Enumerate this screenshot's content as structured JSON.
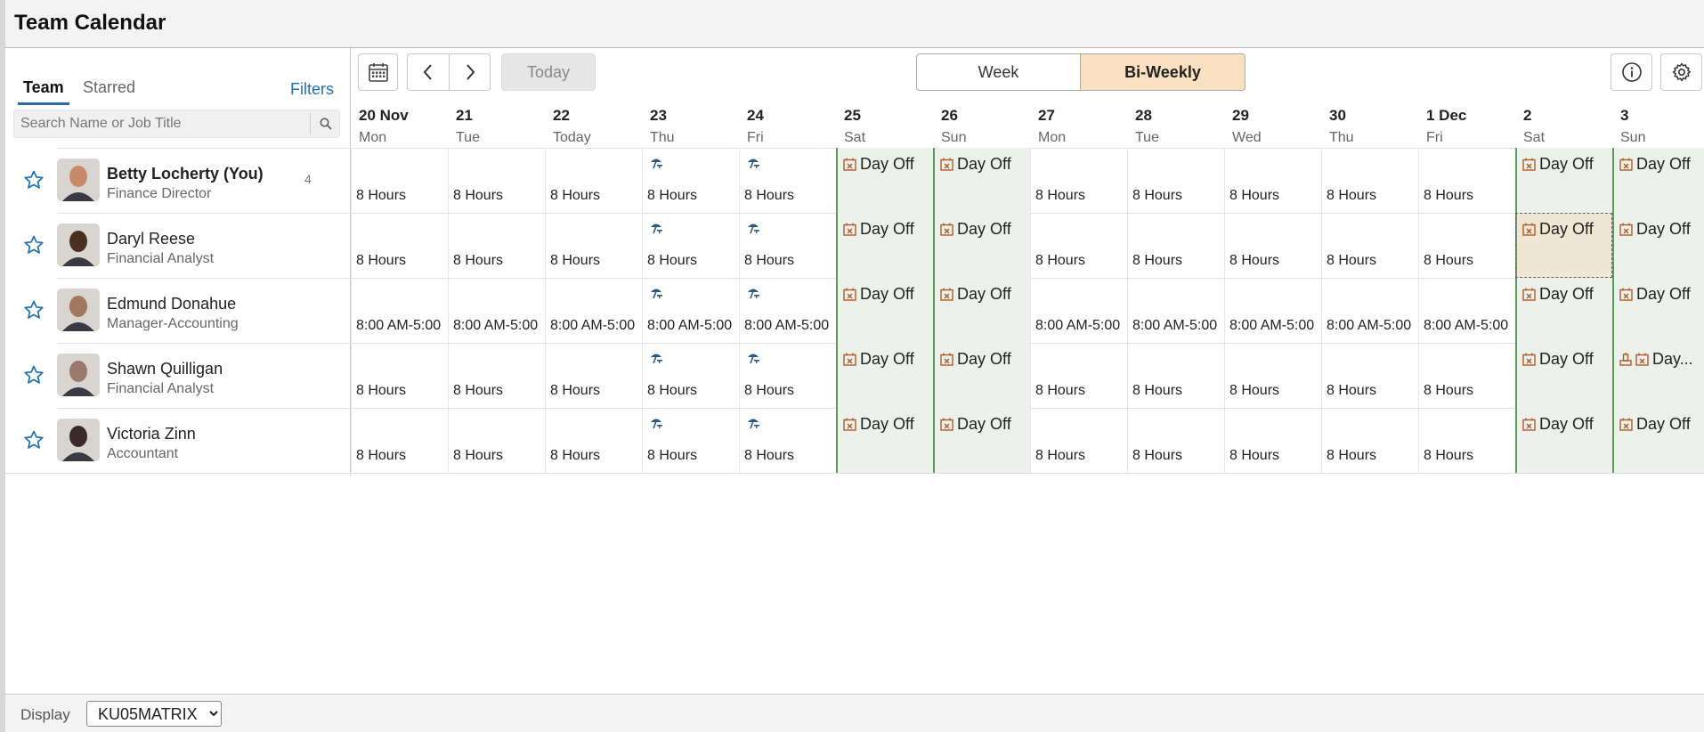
{
  "app": {
    "title": "Team Calendar"
  },
  "tabs": {
    "team": "Team",
    "starred": "Starred"
  },
  "filters_label": "Filters",
  "search": {
    "placeholder": "Search Name or Job Title"
  },
  "toolbar": {
    "today": "Today",
    "week": "Week",
    "biweekly": "Bi-Weekly"
  },
  "colors": {
    "accent": "#1f6fb0",
    "selected_view": "#f8e0c0",
    "weekend": "#ecf2eb",
    "weekend_border": "#5c9a5c",
    "day_off_icon": "#b05a2a",
    "holiday_icon": "#2a5a80"
  },
  "days": [
    {
      "date": "20 Nov",
      "wd": "Mon",
      "weekend": false
    },
    {
      "date": "21",
      "wd": "Tue",
      "weekend": false
    },
    {
      "date": "22",
      "wd": "Today",
      "weekend": false
    },
    {
      "date": "23",
      "wd": "Thu",
      "weekend": false
    },
    {
      "date": "24",
      "wd": "Fri",
      "weekend": false
    },
    {
      "date": "25",
      "wd": "Sat",
      "weekend": true
    },
    {
      "date": "26",
      "wd": "Sun",
      "weekend": true
    },
    {
      "date": "27",
      "wd": "Mon",
      "weekend": false
    },
    {
      "date": "28",
      "wd": "Tue",
      "weekend": false
    },
    {
      "date": "29",
      "wd": "Wed",
      "weekend": false
    },
    {
      "date": "30",
      "wd": "Thu",
      "weekend": false
    },
    {
      "date": "1 Dec",
      "wd": "Fri",
      "weekend": false
    },
    {
      "date": "2",
      "wd": "Sat",
      "weekend": true
    },
    {
      "date": "3",
      "wd": "Sun",
      "weekend": true
    }
  ],
  "day_off_label": "Day Off",
  "employees": [
    {
      "name": "Betty Locherty (You)",
      "job": "Finance Director",
      "count": "4",
      "bold": true,
      "hue": "#c98a6a",
      "cells": [
        "8 Hours",
        "8 Hours",
        "8 Hours",
        "H:8 Hours",
        "H:8 Hours",
        "OFF",
        "OFF",
        "8 Hours",
        "8 Hours",
        "8 Hours",
        "8 Hours",
        "8 Hours",
        "OFF",
        "OFF"
      ]
    },
    {
      "name": "Daryl Reese",
      "job": "Financial Analyst",
      "count": "",
      "bold": false,
      "hue": "#4a3020",
      "cells": [
        "8 Hours",
        "8 Hours",
        "8 Hours",
        "H:8 Hours",
        "H:8 Hours",
        "OFF",
        "OFF",
        "8 Hours",
        "8 Hours",
        "8 Hours",
        "8 Hours",
        "8 Hours",
        "OFF-SEL",
        "OFF"
      ]
    },
    {
      "name": "Edmund Donahue",
      "job": "Manager-Accounting",
      "count": "",
      "bold": false,
      "hue": "#a07860",
      "cells": [
        "8:00 AM-5:00",
        "8:00 AM-5:00",
        "8:00 AM-5:00",
        "H:8:00 AM-5:00",
        "H:8:00 AM-5:00",
        "OFF",
        "OFF",
        "8:00 AM-5:00",
        "8:00 AM-5:00",
        "8:00 AM-5:00",
        "8:00 AM-5:00",
        "8:00 AM-5:00",
        "OFF",
        "OFF"
      ]
    },
    {
      "name": "Shawn Quilligan",
      "job": "Financial Analyst",
      "count": "",
      "bold": false,
      "hue": "#9a7a6a",
      "cells": [
        "8 Hours",
        "8 Hours",
        "8 Hours",
        "H:8 Hours",
        "H:8 Hours",
        "OFF",
        "OFF",
        "8 Hours",
        "8 Hours",
        "8 Hours",
        "8 Hours",
        "8 Hours",
        "OFF",
        "OFF-MULTI"
      ]
    },
    {
      "name": "Victoria Zinn",
      "job": "Accountant",
      "count": "",
      "bold": false,
      "hue": "#3a2a2a",
      "cells": [
        "8 Hours",
        "8 Hours",
        "8 Hours",
        "H:8 Hours",
        "H:8 Hours",
        "OFF",
        "OFF",
        "8 Hours",
        "8 Hours",
        "8 Hours",
        "8 Hours",
        "8 Hours",
        "OFF",
        "OFF"
      ]
    }
  ],
  "multi_day_off_label": "Day...",
  "footer": {
    "display_label": "Display",
    "display_value": "KU05MATRIX"
  }
}
